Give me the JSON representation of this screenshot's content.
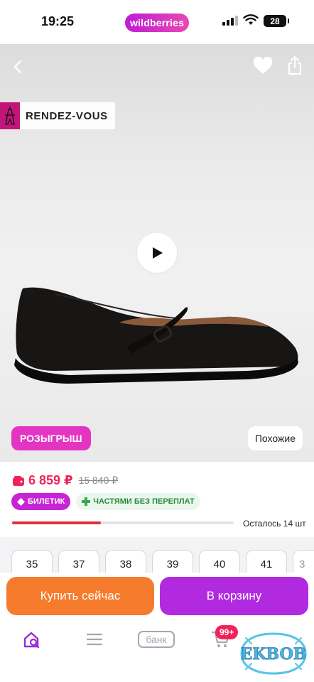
{
  "status_bar": {
    "time": "19:25",
    "app_label": "wildberries",
    "battery": "28"
  },
  "brand": {
    "name": "RENDEZ-VOUS"
  },
  "media": {
    "giveaway_label": "РОЗЫГРЫШ",
    "similar_label": "Похожие"
  },
  "pricing": {
    "price": "6 859 ₽",
    "old_price": "15 840 ₽",
    "ticket_badge": "БИЛЕТИК",
    "installments_badge": "ЧАСТЯМИ БЕЗ ПЕРЕПЛАТ"
  },
  "stock": {
    "remaining_text": "Осталось 14 шт",
    "level_percent": 40
  },
  "sizes": [
    "35",
    "37",
    "38",
    "39",
    "40",
    "41",
    "3"
  ],
  "actions": {
    "buy_now": "Купить сейчас",
    "add_to_cart": "В корзину"
  },
  "bottom_nav": {
    "bank_label": "банк",
    "cart_count": "99+"
  },
  "watermark": {
    "text": "EKBOB"
  },
  "colors": {
    "accent": "#b22ae0",
    "price": "#f0245a",
    "buy_now": "#f67b2c"
  }
}
